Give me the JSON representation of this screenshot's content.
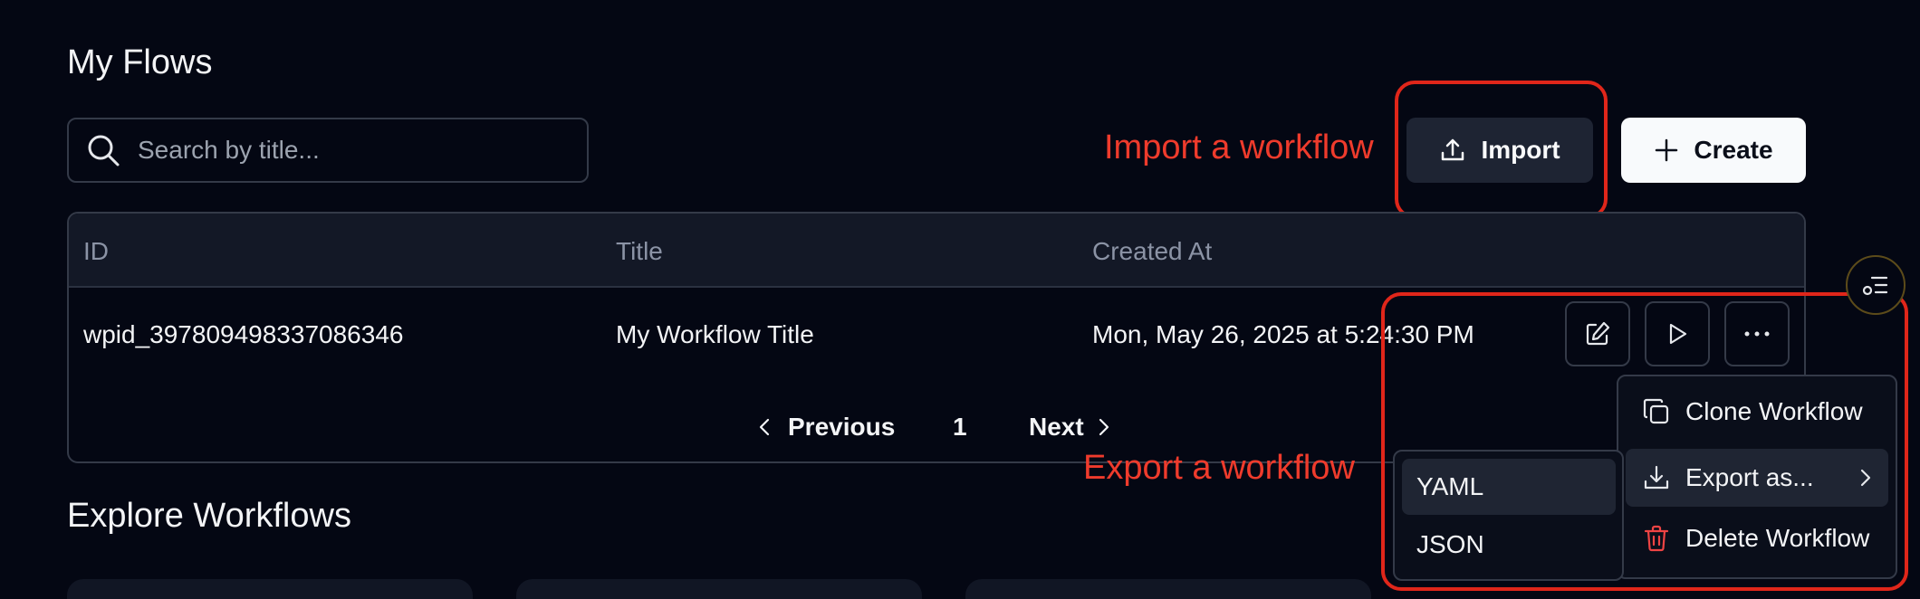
{
  "page": {
    "my_flows_title": "My Flows",
    "explore_title": "Explore Workflows"
  },
  "search": {
    "placeholder": "Search by title..."
  },
  "toolbar": {
    "import_label": "Import",
    "create_label": "Create"
  },
  "annotations": {
    "import": "Import a workflow",
    "export": "Export a workflow",
    "color": "#ef3b2c"
  },
  "table": {
    "columns": [
      "ID",
      "Title",
      "Created At"
    ],
    "rows": [
      {
        "id": "wpid_397809498337086346",
        "title": "My Workflow Title",
        "created_at": "Mon, May 26, 2025 at 5:24:30 PM"
      }
    ]
  },
  "pagination": {
    "previous": "Previous",
    "current_page": "1",
    "next": "Next"
  },
  "row_menu": {
    "items": [
      "Clone Workflow",
      "Export as...",
      "Delete Workflow"
    ]
  },
  "export_submenu": {
    "items": [
      "YAML",
      "JSON"
    ],
    "selected": "YAML"
  },
  "icons": {
    "search": "search-icon",
    "import": "upload-icon",
    "create": "plus-icon",
    "edit": "edit-icon",
    "run": "play-icon",
    "more": "ellipsis-icon",
    "clone": "copy-icon",
    "export": "download-icon",
    "delete": "trash-icon",
    "theme": "theme-toggle-icon"
  },
  "colors": {
    "background": "#040713",
    "delete_icon": "#ef4444",
    "annotation_box": "#e0261a"
  }
}
